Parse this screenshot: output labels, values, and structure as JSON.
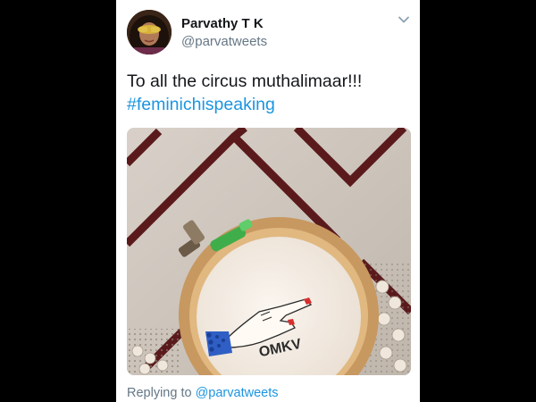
{
  "tweet": {
    "author": {
      "display_name": "Parvathy T K",
      "handle": "@parvatweets",
      "avatar_icon": "profile-photo"
    },
    "text_line1": "To all the circus muthalimaar!!!",
    "hashtag": "#feminichispeaking",
    "image": {
      "description_icon": "embroidery-hoop-photo",
      "embroidered_text": "OMKV"
    },
    "reply": {
      "prefix": "Replying to",
      "handle": "@parvatweets"
    },
    "menu_icon": "chevron-down-icon"
  },
  "colors": {
    "link": "#1b95e0",
    "secondary_text": "#657786",
    "primary_text": "#14171a",
    "side_bars": "#000000"
  }
}
